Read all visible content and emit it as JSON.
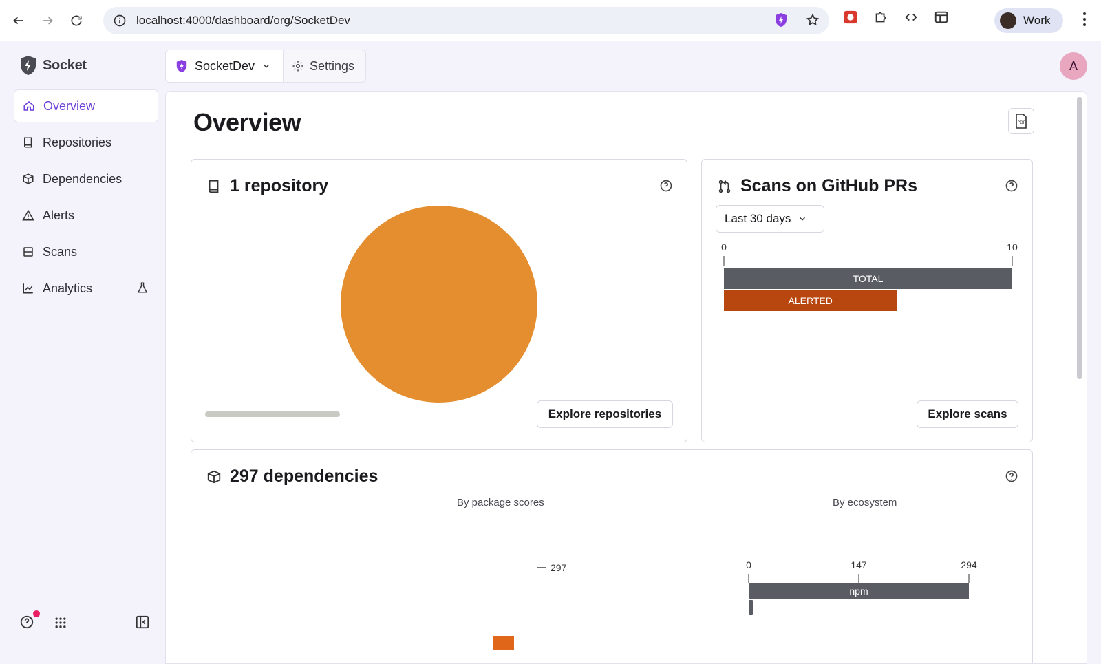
{
  "browser": {
    "url": "localhost:4000/dashboard/org/SocketDev",
    "profile_name": "Work"
  },
  "sidebar": {
    "logo_text": "Socket",
    "items": [
      {
        "label": "Overview",
        "icon": "home-icon",
        "active": true
      },
      {
        "label": "Repositories",
        "icon": "book-icon"
      },
      {
        "label": "Dependencies",
        "icon": "package-icon"
      },
      {
        "label": "Alerts",
        "icon": "warning-icon"
      },
      {
        "label": "Scans",
        "icon": "scan-icon"
      },
      {
        "label": "Analytics",
        "icon": "chart-line-icon",
        "badge_icon": "flask-icon"
      }
    ]
  },
  "topbar": {
    "org_name": "SocketDev",
    "settings_label": "Settings",
    "avatar_initial": "A"
  },
  "page": {
    "title": "Overview"
  },
  "repositories_card": {
    "title": "1 repository",
    "button": "Explore repositories"
  },
  "scans_card": {
    "title": "Scans on GitHub PRs",
    "range_selected": "Last 30 days",
    "button": "Explore scans"
  },
  "dependencies_card": {
    "title": "297 dependencies",
    "left_chart_title": "By package scores",
    "right_chart_title": "By ecosystem"
  },
  "colors": {
    "accent": "#6b3fd8",
    "pie_orange": "#e48e2f",
    "bar_gray": "#595c63",
    "bar_alert": "#b8470f"
  },
  "chart_data": [
    {
      "type": "pie",
      "categories": [
        ""
      ],
      "values": [
        1
      ]
    },
    {
      "type": "bar",
      "orientation": "horizontal",
      "categories": [
        "TOTAL",
        "ALERTED"
      ],
      "values": [
        10,
        6
      ],
      "xlim": [
        0,
        10
      ],
      "ticks": [
        "0",
        "10"
      ]
    },
    {
      "type": "bar",
      "title": "By package scores",
      "values": [
        297
      ],
      "data_labels": [
        "297"
      ]
    },
    {
      "type": "bar",
      "orientation": "horizontal",
      "title": "By ecosystem",
      "categories": [
        "npm"
      ],
      "values": [
        294
      ],
      "xlim": [
        0,
        294
      ],
      "ticks": [
        "0",
        "147",
        "294"
      ]
    }
  ]
}
